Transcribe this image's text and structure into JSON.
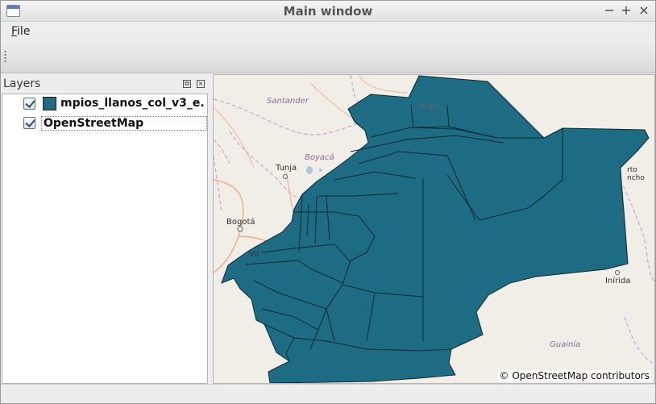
{
  "window": {
    "title": "Main window",
    "minimize_glyph": "−",
    "maximize_glyph": "+",
    "close_glyph": "×"
  },
  "menu": {
    "file_mnemonic": "F",
    "file_rest": "ile"
  },
  "layers_panel": {
    "title": "Layers",
    "float_glyph": "⧉",
    "close_glyph": "×",
    "layers": [
      {
        "label": "mpios_llanos_col_v3_e...",
        "checked": true,
        "color": "#1e6c84"
      },
      {
        "label": "OpenStreetMap",
        "checked": true
      }
    ]
  },
  "map": {
    "place_labels": [
      "Santander",
      "Boyacá",
      "Tunja",
      "Bogotá",
      "Arauca",
      "Puerto Carreño",
      "Inírida",
      "Guainía",
      "Vi"
    ],
    "visible_labels": {
      "santander": "Santander",
      "boyaca": "Boyacá",
      "tunja": "Tunja",
      "bogota": "Bogotá",
      "arauca": "Arau",
      "puerto_1": "rto",
      "puerto_2": "ncho",
      "inirida": "Inírida",
      "guainia": "Guainía",
      "villavicencio_frag": "Vil"
    },
    "attribution": "© OpenStreetMap contributors",
    "polygon_fill": "#1e6c84",
    "background": "#f1eee8"
  }
}
